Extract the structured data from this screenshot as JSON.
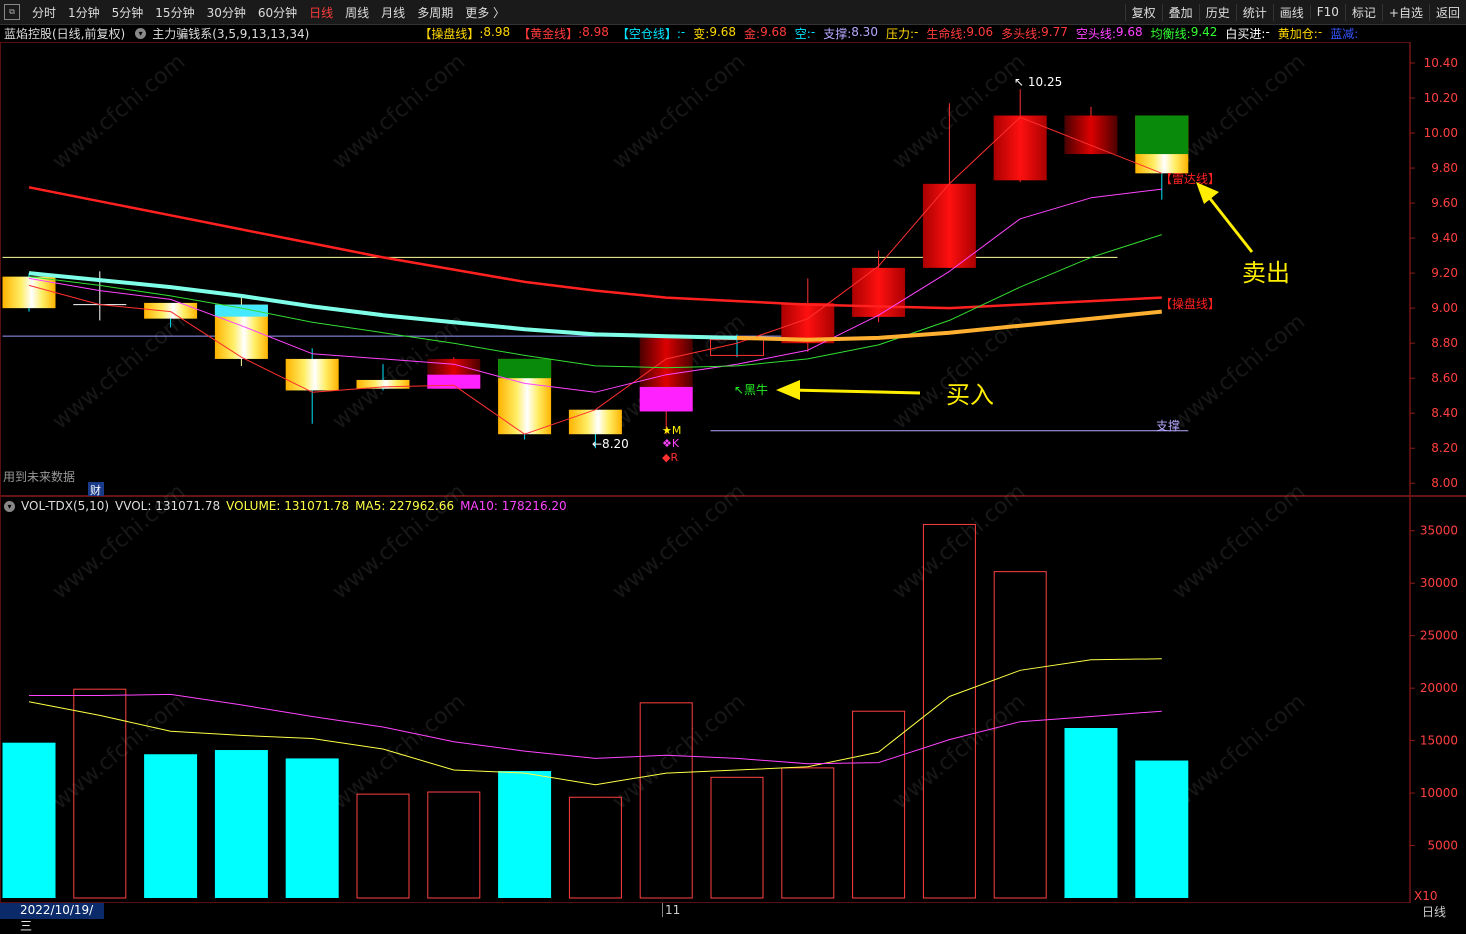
{
  "toolbar": {
    "tabs": [
      "分时",
      "1分钟",
      "5分钟",
      "15分钟",
      "30分钟",
      "60分钟",
      "日线",
      "周线",
      "月线",
      "多周期",
      "更多 〉"
    ],
    "active_tab": "日线",
    "right": [
      "复权",
      "叠加",
      "历史",
      "统计",
      "画线",
      "F10",
      "标记",
      "+自选",
      "返回"
    ]
  },
  "info": {
    "stock": "蓝焰控股(日线,前复权)",
    "indicator": "主力骗钱系(3,5,9,13,13,34)",
    "items": [
      {
        "label": "【操盘线】:",
        "value": "8.98",
        "label_color": "#ffd700",
        "value_color": "#ffd700"
      },
      {
        "label": "【黄金线】:",
        "value": "8.98",
        "label_color": "#ff3b3b",
        "value_color": "#ff3b3b"
      },
      {
        "label": "【空仓线】:",
        "value": "-",
        "label_color": "#00e5ff",
        "value_color": "#00e5ff"
      },
      {
        "label": "变:",
        "value": "9.68",
        "label_color": "#ffd700",
        "value_color": "#ffd700"
      },
      {
        "label": "金:",
        "value": "9.68",
        "label_color": "#ff3b3b",
        "value_color": "#ff3b3b"
      },
      {
        "label": "空:",
        "value": "-",
        "label_color": "#00e5ff",
        "value_color": "#00e5ff"
      },
      {
        "label": "支撑:",
        "value": "8.30",
        "label_color": "#b7a8ff",
        "value_color": "#b7a8ff"
      },
      {
        "label": "压力:",
        "value": "-",
        "label_color": "#ffd700",
        "value_color": "#ffd700"
      },
      {
        "label": "生命线:",
        "value": "9.06",
        "label_color": "#ff3b3b",
        "value_color": "#ff3b3b"
      },
      {
        "label": "多头线:",
        "value": "9.77",
        "label_color": "#ff3b3b",
        "value_color": "#ff3b3b"
      },
      {
        "label": "空头线:",
        "value": "9.68",
        "label_color": "#ff44ff",
        "value_color": "#ff44ff"
      },
      {
        "label": "均衡线:",
        "value": "9.42",
        "label_color": "#33ff33",
        "value_color": "#33ff33"
      },
      {
        "label": "白买进:",
        "value": "-",
        "label_color": "#ffffff",
        "value_color": "#ffffff"
      },
      {
        "label": "黄加仓:",
        "value": "-",
        "label_color": "#ffd700",
        "value_color": "#ffd700"
      },
      {
        "label": "蓝减:",
        "value": "",
        "label_color": "#3355ff",
        "value_color": "#3355ff"
      }
    ]
  },
  "vol": {
    "name": "VOL-TDX(5,10)",
    "vvol": "VVOL: 131071.78",
    "volume": "VOLUME: 131071.78",
    "ma5": "MA5: 227962.66",
    "ma10": "MA10: 178216.20"
  },
  "watermark": "www.cfchi.com",
  "future_data": "用到未来数据",
  "cai": "财",
  "bottom": {
    "date": "2022/10/19/三",
    "mid": "11",
    "period": "日线"
  },
  "chart_data": [
    {
      "type": "candlestick",
      "ylim": [
        7.95,
        10.52
      ],
      "yticks": [
        8.0,
        8.2,
        8.4,
        8.6,
        8.8,
        9.0,
        9.2,
        9.4,
        9.6,
        9.8,
        10.0,
        10.2,
        10.4
      ],
      "ohlc": [
        {
          "o": 9.18,
          "h": 9.2,
          "l": 8.98,
          "c": 9.0,
          "style": "gold"
        },
        {
          "o": 9.02,
          "h": 9.21,
          "l": 8.93,
          "c": 9.02,
          "style": "doji"
        },
        {
          "o": 8.94,
          "h": 9.03,
          "l": 8.89,
          "c": 9.03,
          "style": "gold"
        },
        {
          "o": 9.02,
          "h": 9.07,
          "l": 8.67,
          "c": 8.71,
          "style": "gold_cyan"
        },
        {
          "o": 8.71,
          "h": 8.77,
          "l": 8.34,
          "c": 8.53,
          "style": "gold"
        },
        {
          "o": 8.59,
          "h": 8.68,
          "l": 8.53,
          "c": 8.54,
          "style": "gold"
        },
        {
          "o": 8.71,
          "h": 8.72,
          "l": 8.54,
          "c": 8.54,
          "style": "red_magenta"
        },
        {
          "o": 8.71,
          "h": 8.71,
          "l": 8.25,
          "c": 8.28,
          "style": "gold_green"
        },
        {
          "o": 8.42,
          "h": 8.42,
          "l": 8.2,
          "c": 8.28,
          "style": "gold"
        },
        {
          "o": 8.41,
          "h": 8.83,
          "l": 8.28,
          "c": 8.83,
          "style": "red_magenta"
        },
        {
          "o": 8.73,
          "h": 8.85,
          "l": 8.72,
          "c": 8.82,
          "style": "hollow"
        },
        {
          "o": 8.8,
          "h": 9.17,
          "l": 8.75,
          "c": 9.03,
          "style": "red"
        },
        {
          "o": 8.95,
          "h": 9.33,
          "l": 8.92,
          "c": 9.23,
          "style": "red"
        },
        {
          "o": 9.23,
          "h": 10.17,
          "l": 9.23,
          "c": 9.71,
          "style": "red"
        },
        {
          "o": 9.73,
          "h": 10.25,
          "l": 9.72,
          "c": 10.1,
          "style": "red"
        },
        {
          "o": 10.1,
          "h": 10.15,
          "l": 9.88,
          "c": 9.88,
          "style": "darkred"
        },
        {
          "o": 10.1,
          "h": 10.1,
          "l": 9.62,
          "c": 9.77,
          "style": "gold_green"
        }
      ],
      "lines": [
        {
          "name": "生命线",
          "color": "#ff2020",
          "width": 2.5,
          "values": [
            9.69,
            9.61,
            9.53,
            9.45,
            9.37,
            9.29,
            9.22,
            9.15,
            9.1,
            9.06,
            9.04,
            9.02,
            9.01,
            9.0,
            9.02,
            9.04,
            9.06
          ]
        },
        {
          "name": "多头线",
          "color": "#ff3030",
          "width": 1,
          "values": [
            9.13,
            9.02,
            8.98,
            8.72,
            8.52,
            8.55,
            8.56,
            8.28,
            8.42,
            8.71,
            8.8,
            8.94,
            9.24,
            9.71,
            10.09,
            9.93,
            9.77
          ]
        },
        {
          "name": "空头线",
          "color": "#ff44ff",
          "width": 1,
          "values": [
            9.17,
            9.1,
            9.05,
            8.9,
            8.74,
            8.71,
            8.68,
            8.57,
            8.52,
            8.62,
            8.68,
            8.76,
            8.96,
            9.21,
            9.51,
            9.63,
            9.68
          ]
        },
        {
          "name": "均衡线",
          "color": "#33dd33",
          "width": 1,
          "values": [
            9.18,
            9.13,
            9.07,
            9.0,
            8.92,
            8.86,
            8.8,
            8.73,
            8.67,
            8.66,
            8.67,
            8.71,
            8.79,
            8.93,
            9.12,
            9.29,
            9.42
          ]
        },
        {
          "name": "空仓线",
          "color": "#80ffe8",
          "width": 4,
          "values": [
            9.2,
            9.16,
            9.12,
            9.07,
            9.01,
            8.96,
            8.92,
            8.88,
            8.85,
            8.84,
            8.83,
            null,
            null,
            null,
            null,
            null,
            null
          ]
        },
        {
          "name": "操盘线",
          "color": "#ffb030",
          "width": 4,
          "values": [
            null,
            null,
            null,
            null,
            null,
            null,
            null,
            null,
            null,
            null,
            8.83,
            8.82,
            8.83,
            8.86,
            8.9,
            8.94,
            8.98
          ]
        }
      ],
      "hlines": [
        {
          "value": 9.29,
          "color": "#ffff99",
          "x0": 0,
          "x1": 15
        },
        {
          "value": 8.84,
          "color": "#9999ff",
          "x0": 0,
          "x1": 11
        },
        {
          "value": 8.3,
          "color": "#b7a8ff",
          "x0": 10,
          "x1": 16
        }
      ],
      "annotations": {
        "high": "10.25",
        "low": "←8.20",
        "radar": "【雷达线】",
        "caopan": "【操盘线】",
        "sell": "卖出",
        "buy": "买入",
        "heiniu": "↖黑牛",
        "support": "支撑",
        "mkr": [
          "★M",
          "❖K",
          "◆R"
        ]
      }
    },
    {
      "type": "bar",
      "name": "VOL",
      "ylim": [
        0,
        36500
      ],
      "yticks": [
        5000,
        10000,
        15000,
        20000,
        25000,
        30000,
        35000
      ],
      "values": [
        14800,
        19900,
        13700,
        14100,
        13300,
        9900,
        10100,
        12100,
        9600,
        18600,
        11500,
        12400,
        17800,
        35600,
        31100,
        16200,
        13100
      ],
      "bar_style": [
        "cyan",
        "hollow",
        "cyan",
        "cyan",
        "cyan",
        "hollow",
        "hollow",
        "cyan",
        "hollow",
        "hollow",
        "hollow",
        "hollow",
        "hollow",
        "hollow",
        "hollow",
        "cyan",
        "cyan"
      ],
      "ma5": [
        18700,
        17400,
        15900,
        15500,
        15200,
        14200,
        12200,
        11900,
        10800,
        11900,
        12200,
        12500,
        13900,
        19200,
        21700,
        22700,
        22800
      ],
      "ma10": [
        19300,
        19300,
        19400,
        18400,
        17300,
        16300,
        14900,
        14000,
        13300,
        13600,
        13300,
        12800,
        12900,
        15100,
        16800,
        17300,
        17800
      ],
      "ma5_color": "#ffff44",
      "ma10_color": "#ff44ff",
      "x10_label": "X10"
    }
  ]
}
